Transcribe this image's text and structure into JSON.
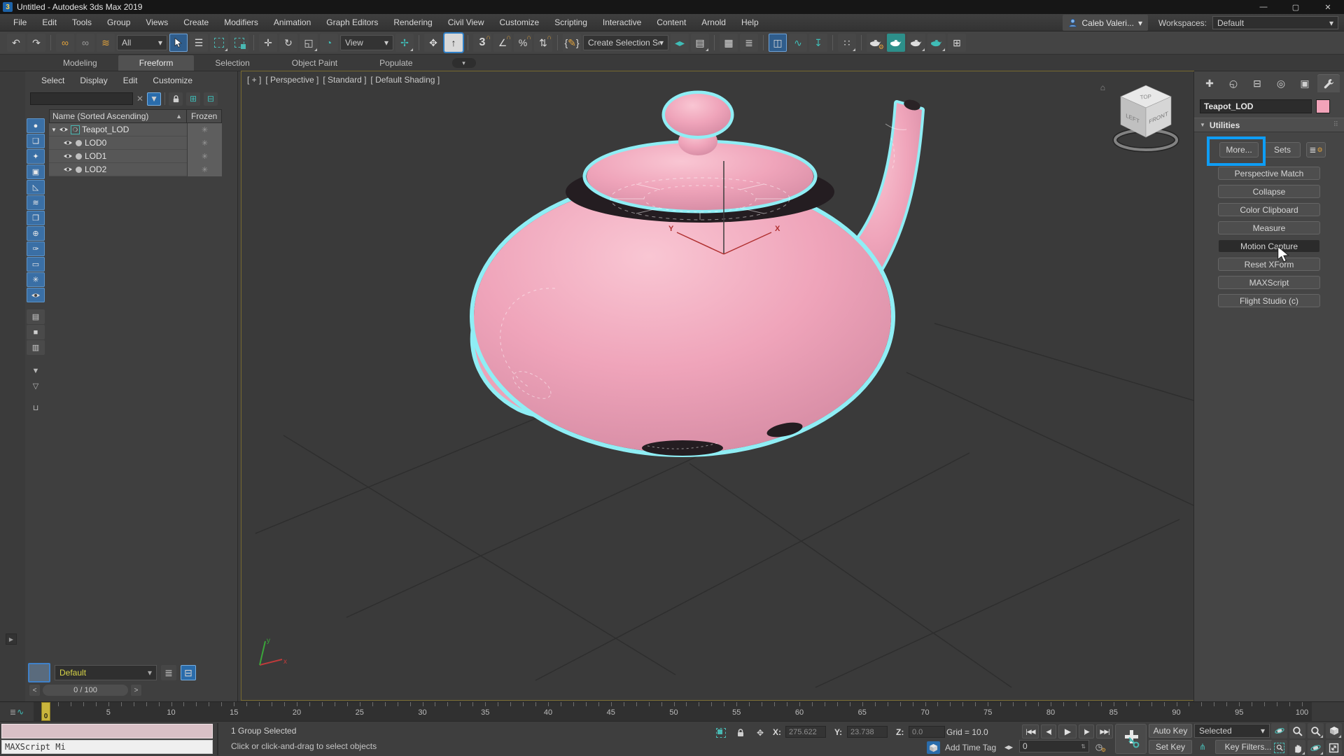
{
  "window": {
    "title": "Untitled - Autodesk 3ds Max 2019",
    "logo": "3",
    "minimize": "—",
    "maximize": "▢",
    "close": "✕"
  },
  "menubar": {
    "items": [
      "File",
      "Edit",
      "Tools",
      "Group",
      "Views",
      "Create",
      "Modifiers",
      "Animation",
      "Graph Editors",
      "Rendering",
      "Civil View",
      "Customize",
      "Scripting",
      "Interactive",
      "Content",
      "Arnold",
      "Help"
    ],
    "user": "Caleb Valeri...",
    "workspaces_label": "Workspaces:",
    "workspace": "Default"
  },
  "toolbar": {
    "filter": "All",
    "coord_system": "View",
    "selection_set": "Create Selection Se"
  },
  "ribbon": {
    "tabs": [
      "Modeling",
      "Freeform",
      "Selection",
      "Object Paint",
      "Populate"
    ]
  },
  "explorer": {
    "menu": [
      "Select",
      "Display",
      "Edit",
      "Customize"
    ],
    "name_col": "Name (Sorted Ascending)",
    "frozen_col": "Frozen",
    "rows": [
      {
        "label": "Teapot_LOD"
      },
      {
        "label": "LOD0"
      },
      {
        "label": "LOD1"
      },
      {
        "label": "LOD2"
      }
    ],
    "frozen_glyph": "✳",
    "preset": "Default",
    "frame_nav": "0 / 100",
    "nav_prev": "<",
    "nav_next": ">"
  },
  "viewport": {
    "seg_plus": "[ + ]",
    "seg_pov": "[ Perspective ]",
    "seg_standard": "[ Standard ]",
    "seg_shading": "[ Default Shading ]",
    "cube_top": "TOP",
    "cube_left": "LEFT",
    "cube_front": "FRONT",
    "axis_x": "X",
    "axis_y": "Y",
    "tripod_x": "x",
    "tripod_y": "y"
  },
  "panel": {
    "object_name": "Teapot_LOD",
    "rollout": "Utilities",
    "more": "More...",
    "sets": "Sets",
    "utilities": [
      "Perspective Match",
      "Collapse",
      "Color Clipboard",
      "Measure",
      "Motion Capture",
      "Reset XForm",
      "MAXScript",
      "Flight Studio (c)"
    ]
  },
  "timeline": {
    "min": 0,
    "max": 100,
    "label_step": 5,
    "current": "0"
  },
  "status": {
    "listener": "MAXScript Mi",
    "line1": "1 Group Selected",
    "line2": "Click or click-and-drag to select objects",
    "x_label": "X:",
    "x": "275.622",
    "y_label": "Y:",
    "y": "23.738",
    "z_label": "Z:",
    "z": "0.0",
    "grid": "Grid = 10.0",
    "add_time_tag": "Add Time Tag",
    "transport": [
      "|◀◀",
      "◀|",
      "▶",
      "|▶",
      "▶▶|"
    ],
    "frame": "0",
    "auto_key": "Auto Key",
    "set_key": "Set Key",
    "key_mode": "Selected",
    "key_filters": "Key Filters..."
  },
  "colors": {
    "accent_blue": "#0e9df5",
    "steel_blue": "#2a6cab",
    "teal": "#3fbdb7",
    "teapot_pink": "#efa4ba",
    "selection_cyan": "#8feef5",
    "swatch_pink": "#f2a3b9",
    "playhead_yellow": "#c9b53c"
  },
  "icons": {
    "dd": "▾",
    "sort": "▲",
    "expand": "▼",
    "grip": "⠿",
    "undo": "↶",
    "redo": "↷",
    "link": "∞",
    "unlink": "∞",
    "bind_spacewarp": "≋",
    "select_by_name": "☰",
    "move": "✛",
    "rotate": "↻",
    "scale": "◱",
    "place": "◔",
    "pivot_center": "✢",
    "manipulate": "✥",
    "kbd_override": "↑",
    "snap3": "3",
    "snap_angle": "∠",
    "snap_percent": "%",
    "snap_spinner": "⇅",
    "magnet": "∩",
    "brace_open": "{",
    "brace_close": "}",
    "pen": "✎",
    "mirror": "◂▸",
    "align": "▤",
    "scene_explorer": "▦",
    "layer_explorer": "≣",
    "ribbon_toggle": "◫",
    "curve_editor": "∿",
    "schematic": "↧",
    "particle_view": "∷",
    "render_gallery": "⊞",
    "clear": "✕",
    "funnel": "▼",
    "tree_expand": "⊞",
    "tree_collapse": "⊟",
    "strip": [
      "●",
      "❏",
      "✦",
      "▣",
      "◺",
      "≋",
      "❒",
      "⊕",
      "✑",
      "▭",
      "✳"
    ],
    "strip_gray": [
      "▤",
      "■",
      "▥"
    ],
    "strip_filters": [
      "▼",
      "▽",
      "⊔"
    ],
    "layers": "≣",
    "hierarchy": "⊟",
    "group_marker": "❍",
    "home": "⌂",
    "track_list": "≣",
    "track_wave": "∿",
    "arrows_lr": "◀▶",
    "spin": "⇅",
    "clock": "◷",
    "key_filter_icon": "⋔",
    "tab_create": "✚",
    "tab_modify": "◵",
    "tab_hierarchy": "⊟",
    "tab_motion": "◎",
    "tab_display": "▣",
    "pivot_status": "✥"
  }
}
